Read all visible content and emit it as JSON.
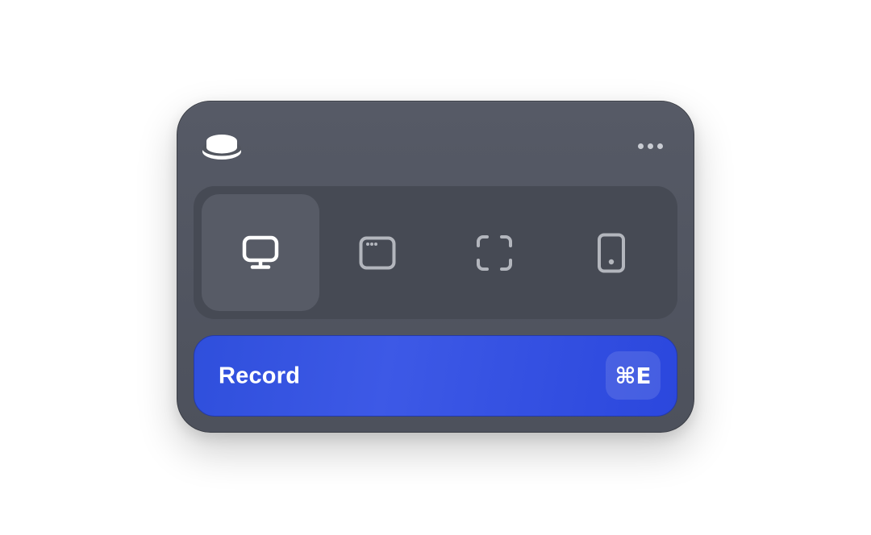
{
  "app": {
    "logo_icon": "record-button-stack-icon",
    "more_icon": "ellipsis-icon"
  },
  "capture_modes": [
    {
      "id": "screen",
      "icon": "monitor-icon",
      "selected": true
    },
    {
      "id": "window",
      "icon": "app-window-icon",
      "selected": false
    },
    {
      "id": "area",
      "icon": "selection-area-icon",
      "selected": false
    },
    {
      "id": "device",
      "icon": "phone-icon",
      "selected": false
    }
  ],
  "record": {
    "label": "Record",
    "shortcut": "⌘E"
  },
  "colors": {
    "panel": "#52565f",
    "mode_bar": "#464a54",
    "selected_mode": "#575b66",
    "accent": "#3350e0",
    "icon_selected": "#ffffff",
    "icon_unselected": "#b3b6bd"
  }
}
